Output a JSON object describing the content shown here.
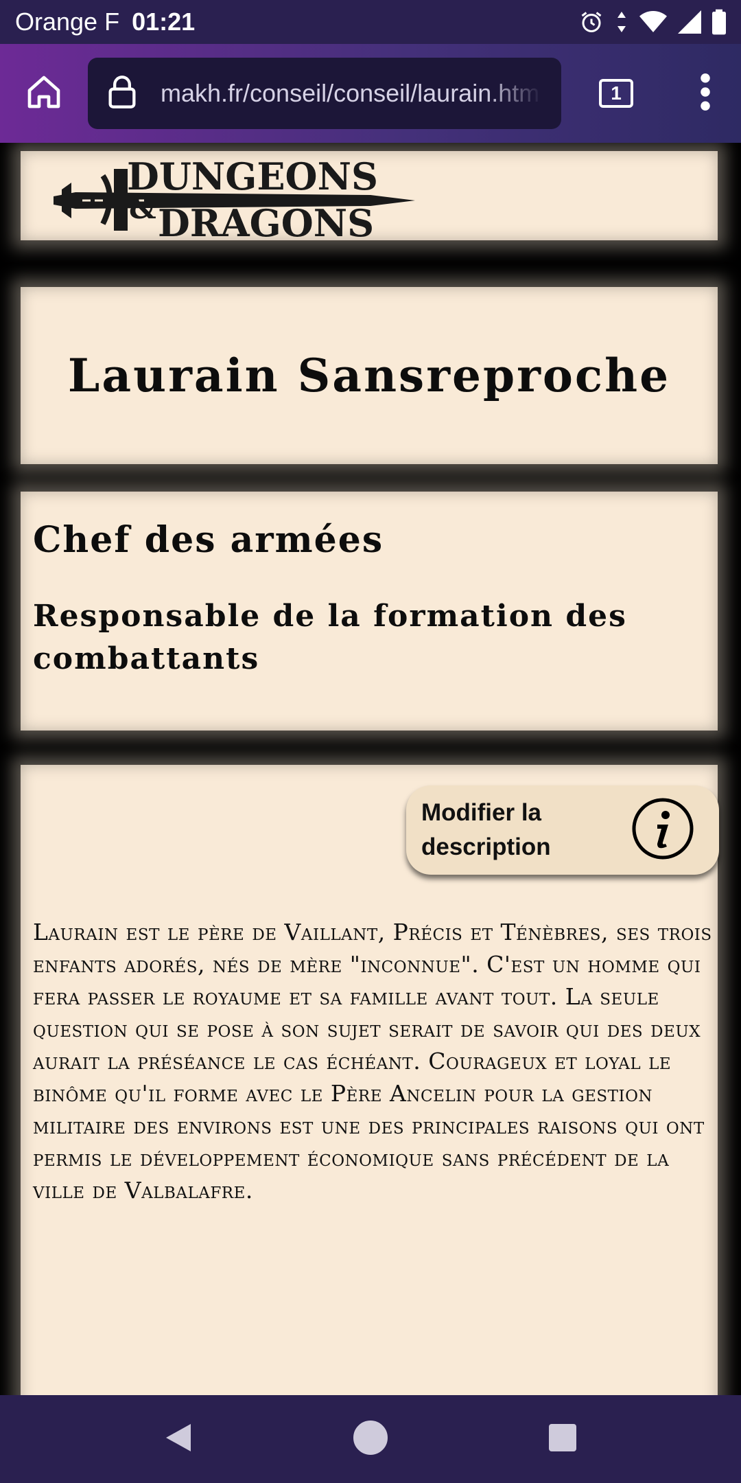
{
  "status_bar": {
    "carrier": "Orange F",
    "time": "01:21"
  },
  "browser": {
    "url": "makh.fr/conseil/conseil/laurain.html",
    "tab_count": "1"
  },
  "page": {
    "logo_alt": "Dungeons & Dragons",
    "name": "Laurain Sansreproche",
    "role_title": "Chef des armées",
    "role_subtitle": "Responsable de la formation des combattants",
    "edit_button_label": "Modifier la description",
    "description": "Laurain est le père de Vaillant, Précis et Ténèbres, ses trois enfants adorés, nés de mère \"inconnue\". C'est un homme qui fera passer le royaume et sa famille avant tout. La seule question qui se pose à son sujet serait de savoir qui des deux aurait la préséance le cas échéant. Courageux et loyal le binôme qu'il forme avec le Père Ancelin pour la gestion militaire des environs est une des principales raisons qui ont permis le développement économique sans précédent de la ville de Valbalafre."
  },
  "icons": {
    "home": "home-icon",
    "lock": "lock-icon",
    "menu": "more-vert-icon",
    "info": "info-icon",
    "alarm": "alarm-icon",
    "wifi": "wifi-icon",
    "signal": "signal-icon",
    "battery": "battery-icon",
    "back": "back-icon",
    "home_nav": "home-circle-icon",
    "recents": "recents-icon"
  },
  "colors": {
    "parchment": "#f9ead7",
    "button": "#f1e0c6",
    "system_bar": "#2a2050",
    "toolbar_gradient_start": "#6d2a96",
    "toolbar_gradient_end": "#2e2a63"
  }
}
